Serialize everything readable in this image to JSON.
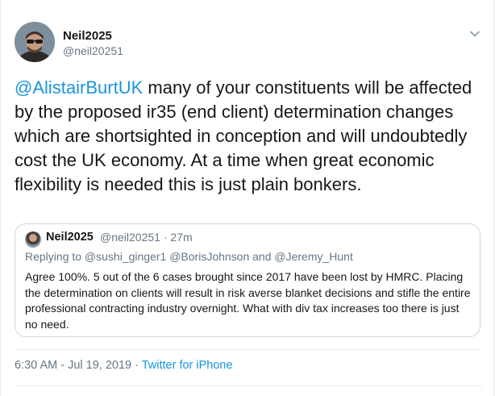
{
  "tweet": {
    "author_name": "Neil2025",
    "author_handle": "@neil20251",
    "mention": "@AlistairBurtUK",
    "text": " many of your constituents will be affected by the proposed ir35 (end client) determination changes which are shortsighted in conception and will undoubtedly cost the UK economy. At a time when great economic flexibility is needed this is just plain bonkers.",
    "timestamp": "6:30 AM - Jul 19, 2019",
    "separator": " · ",
    "source": "Twitter for iPhone"
  },
  "quoted_tweet": {
    "author_name": "Neil2025",
    "meta": "@neil20251 · 27m",
    "reply_line": "Replying to @sushi_ginger1 @BorisJohnson and @Jeremy_Hunt",
    "text": "Agree 100%. 5 out of the 6 cases brought since 2017  have been lost by HMRC. Placing the determination on clients will result in risk averse blanket decisions and stifle the entire professional contracting industry overnight. What with div tax increases too there is just no need."
  },
  "icons": {
    "caret": "chevron-down-icon",
    "avatar": "avatar-image"
  },
  "colors": {
    "link": "#1b95e0",
    "secondary_text": "#657786",
    "primary_text": "#14171a",
    "border": "#ccd6dd"
  }
}
